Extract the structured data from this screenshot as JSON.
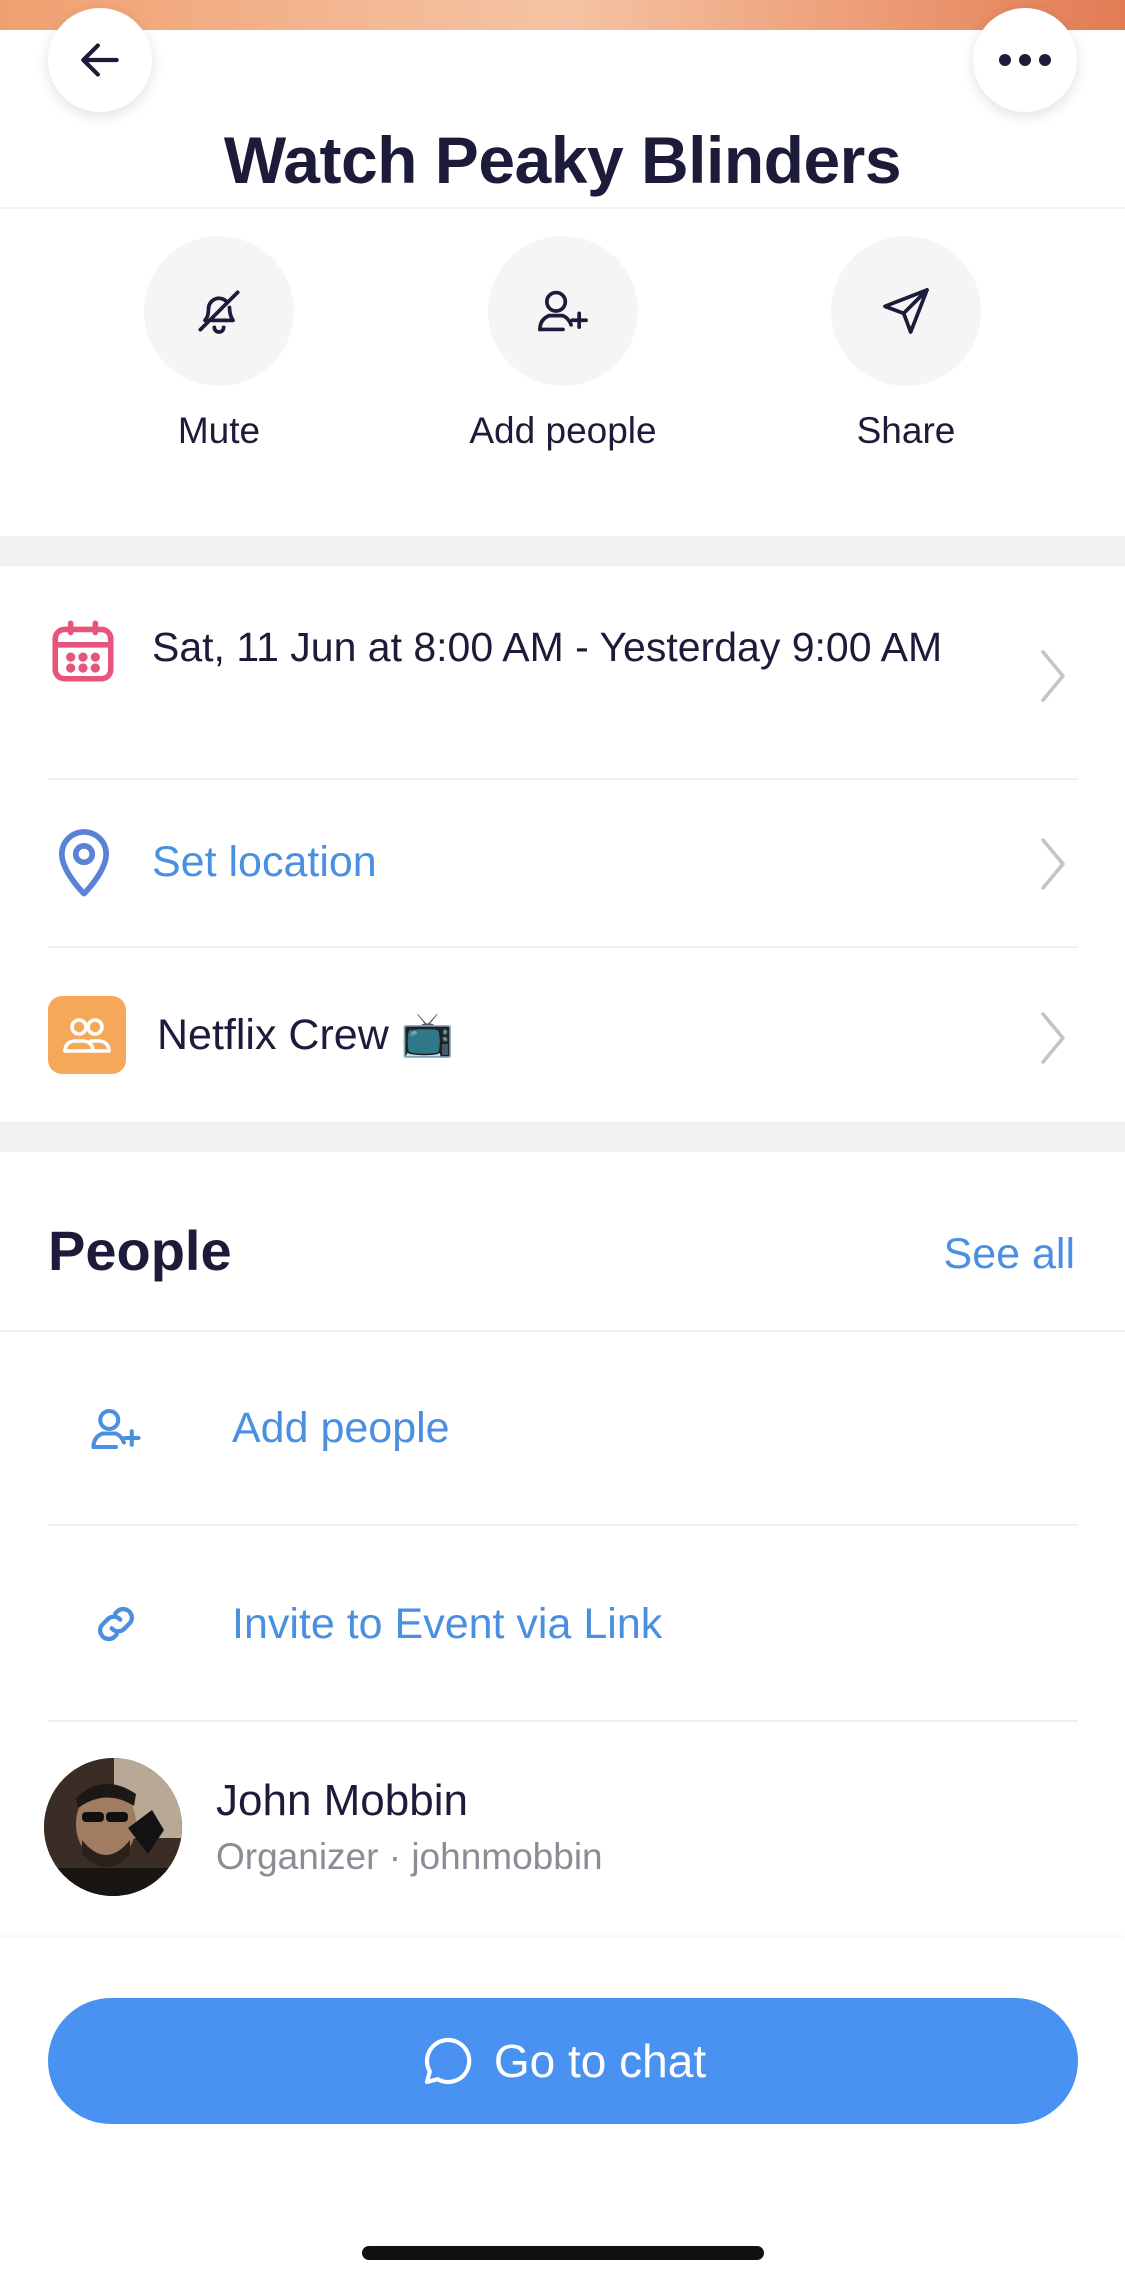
{
  "header": {
    "title": "Watch Peaky Blinders",
    "back_icon": "arrow-left-icon",
    "more_icon": "more-horizontal-icon"
  },
  "actions": [
    {
      "label": "Mute",
      "icon": "bell-off-icon"
    },
    {
      "label": "Add people",
      "icon": "user-plus-icon"
    },
    {
      "label": "Share",
      "icon": "send-icon"
    }
  ],
  "details": {
    "date": "Sat, 11 Jun at 8:00 AM - Yesterday 9:00 AM",
    "location": "Set location",
    "group": "Netflix Crew 📺"
  },
  "people": {
    "title": "People",
    "see_all": "See all",
    "add_people": "Add people",
    "invite_link": "Invite to Event via Link",
    "members": [
      {
        "name": "John Mobbin",
        "subtitle": "Organizer · johnmobbin"
      }
    ]
  },
  "footer": {
    "chat_button": "Go to chat"
  },
  "colors": {
    "accent": "#4a8fe0",
    "button": "#4a92f2",
    "calendar": "#e8557a",
    "group_tile": "#f5a85a"
  }
}
